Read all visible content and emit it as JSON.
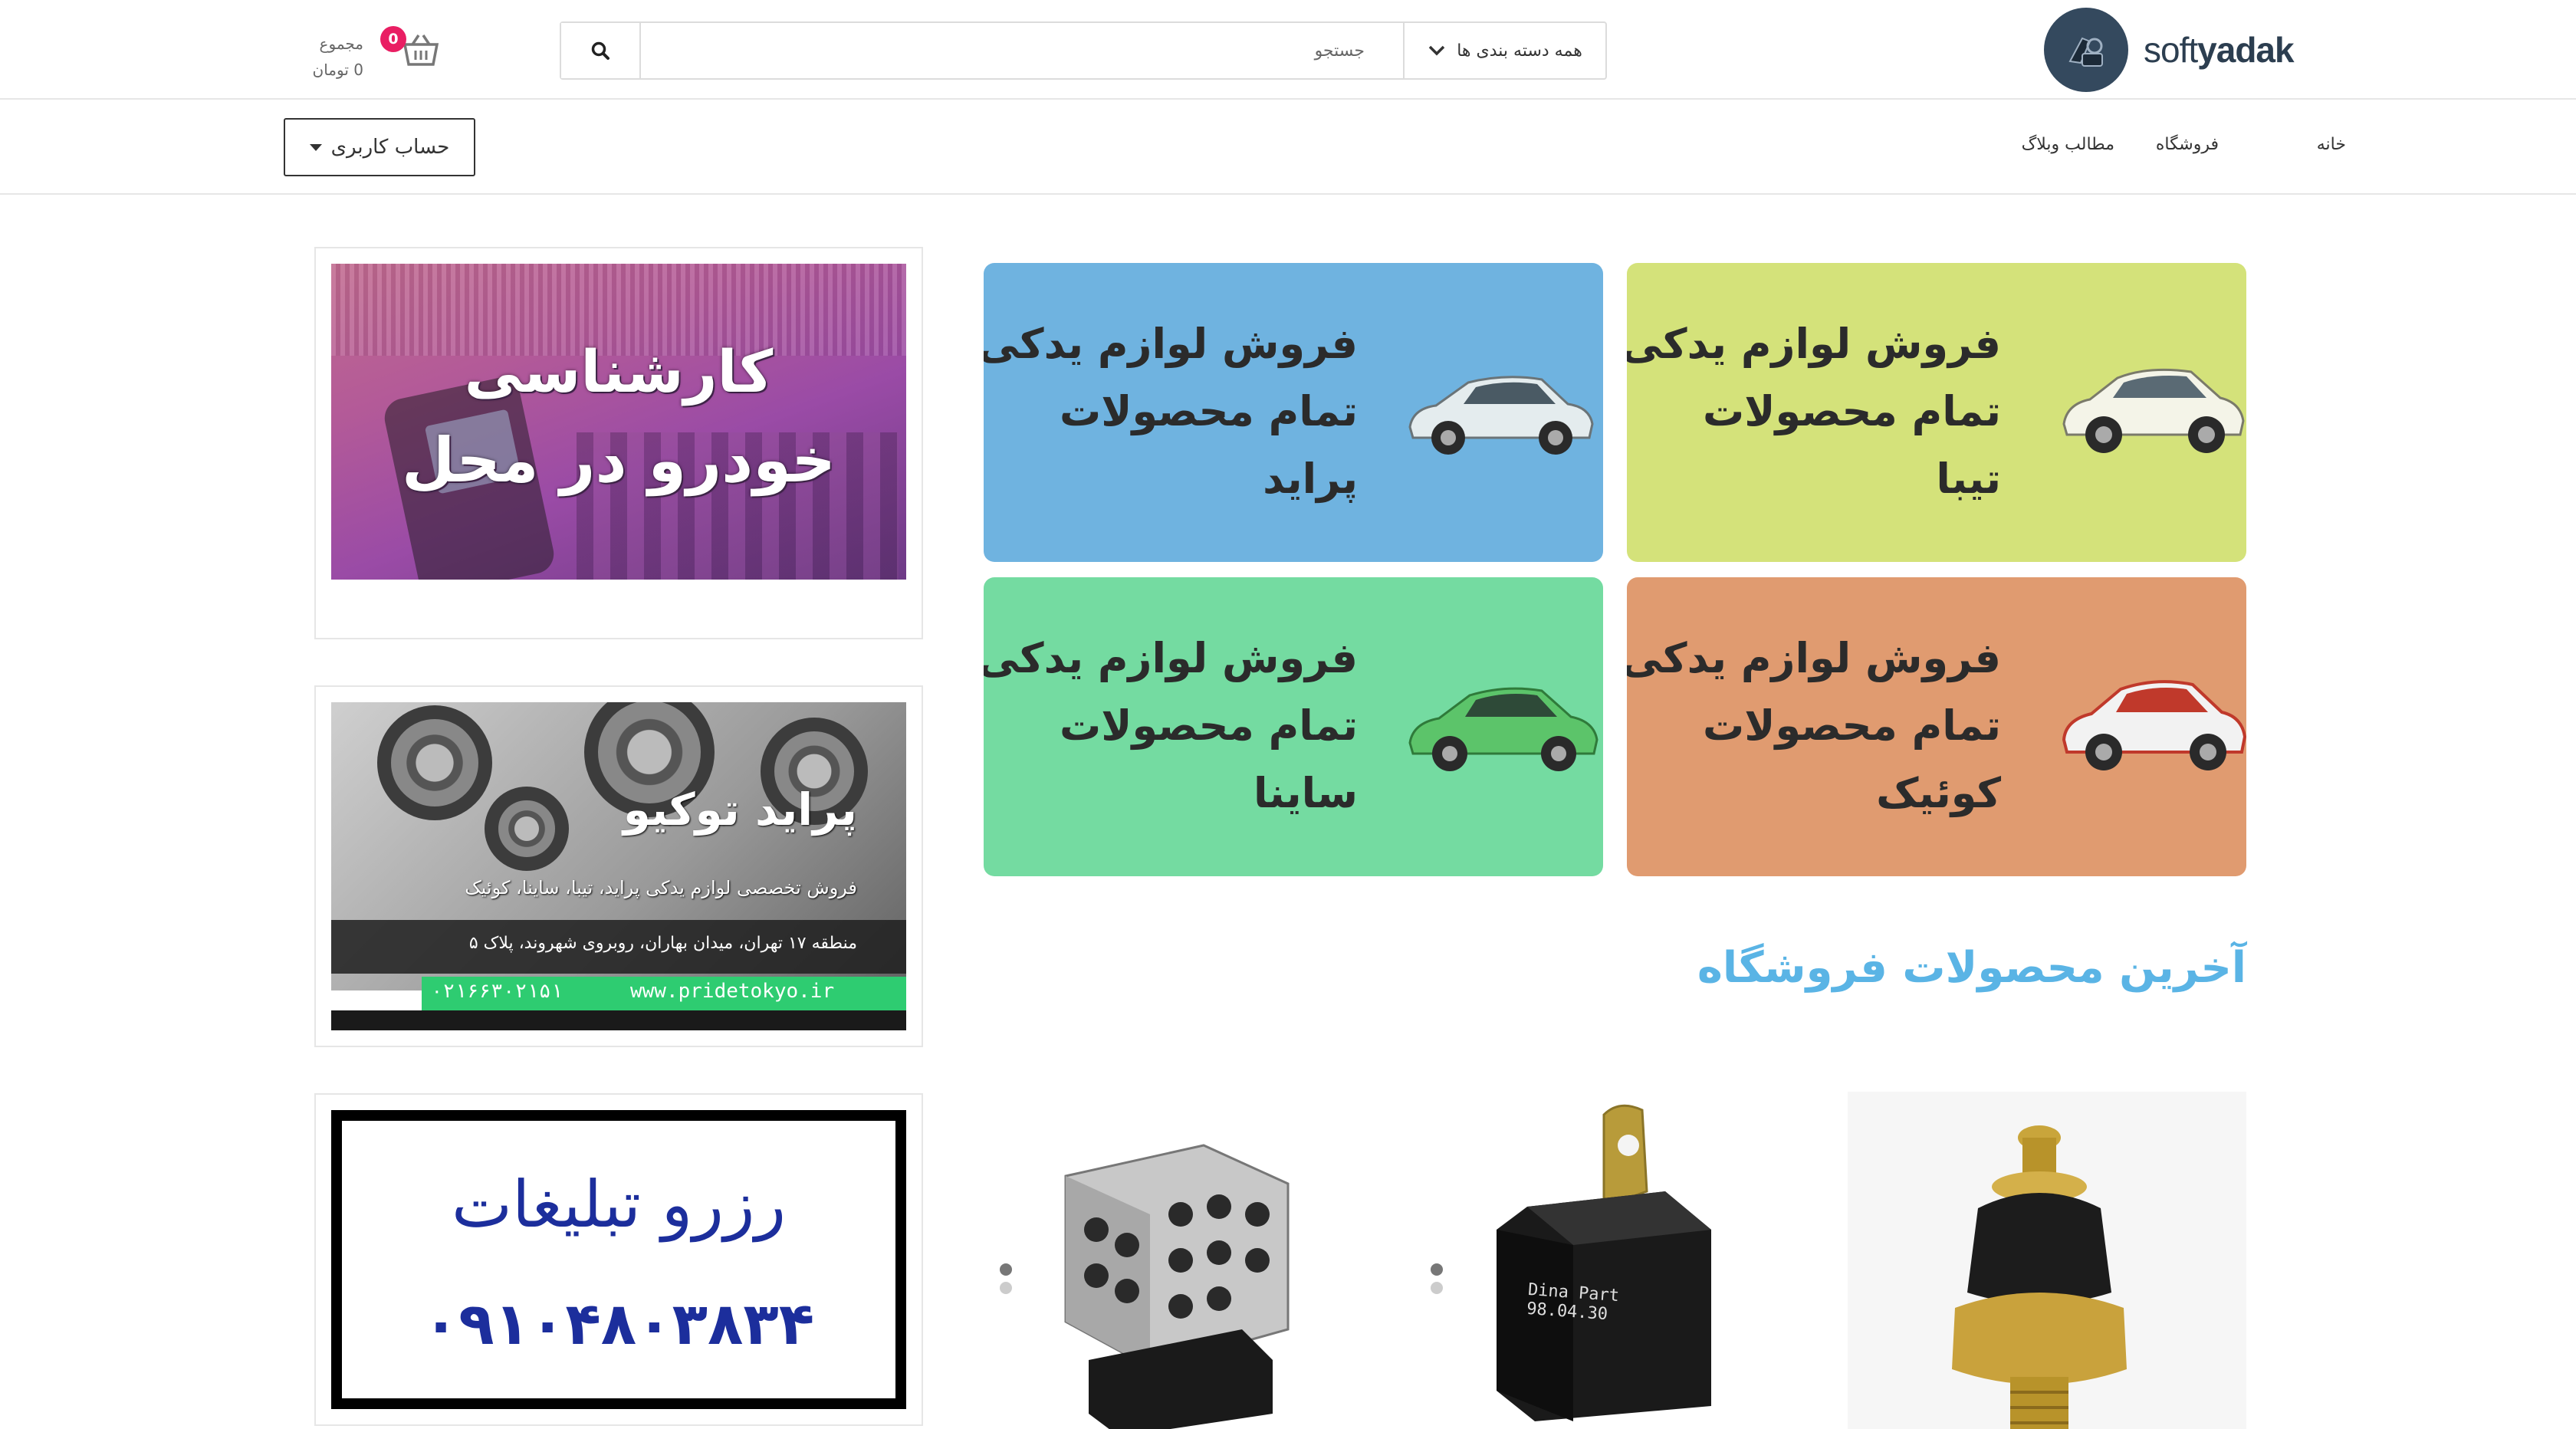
{
  "brand": {
    "logo_text_light": "soft",
    "logo_text_bold": "yadak"
  },
  "search": {
    "placeholder": "جستجو",
    "category_label": "همه دسته بندی ها"
  },
  "cart": {
    "count": "0",
    "label": "مجموع",
    "total": "0 تومان"
  },
  "nav": {
    "items": [
      {
        "label": "خانه"
      },
      {
        "label": "فروشگاه"
      },
      {
        "label": "مطالب وبلاگ"
      }
    ]
  },
  "account": {
    "label": "حساب کاربری"
  },
  "tiles": [
    {
      "line1": "فروش لوازم یدکی",
      "line2": "تمام محصولات",
      "line3": "تیبا",
      "color": "#d4e27a"
    },
    {
      "line1": "فروش لوازم یدکی",
      "line2": "تمام محصولات",
      "line3": "پراید",
      "color": "#6fb3e0"
    },
    {
      "line1": "فروش لوازم یدکی",
      "line2": "تمام محصولات",
      "line3": "کوئیک",
      "color": "#e09b70"
    },
    {
      "line1": "فروش لوازم یدکی",
      "line2": "تمام محصولات",
      "line3": "ساینا",
      "color": "#74dba1"
    }
  ],
  "ads": {
    "expert": {
      "line1": "کارشناسی",
      "line2": "خودرو در محل"
    },
    "pridetokyo": {
      "title": "پراید توکیو",
      "subtitle": "فروش تخصصی لوازم یدکی پراید، تیبا، ساینا، کوئیک",
      "address": "منطقه ۱۷ تهران، میدان بهاران، روبروی شهروند، پلاک ۵",
      "website": "www.pridetokyo.ir",
      "phone": "۰۲۱۶۶۳۰۲۱۵۱"
    },
    "reserve": {
      "line1": "رزرو تبلیغات",
      "line2": "۰۹۱۰۴۸۰۳۸۳۴"
    }
  },
  "latest_products": {
    "title": "آخرین محصولات فروشگاه",
    "relay_text": "Dina Part",
    "relay_date": "98.04.30"
  },
  "colors": {
    "accent": "#5ab4e5",
    "badge": "#e91e63",
    "logo_bg": "#34495e"
  }
}
